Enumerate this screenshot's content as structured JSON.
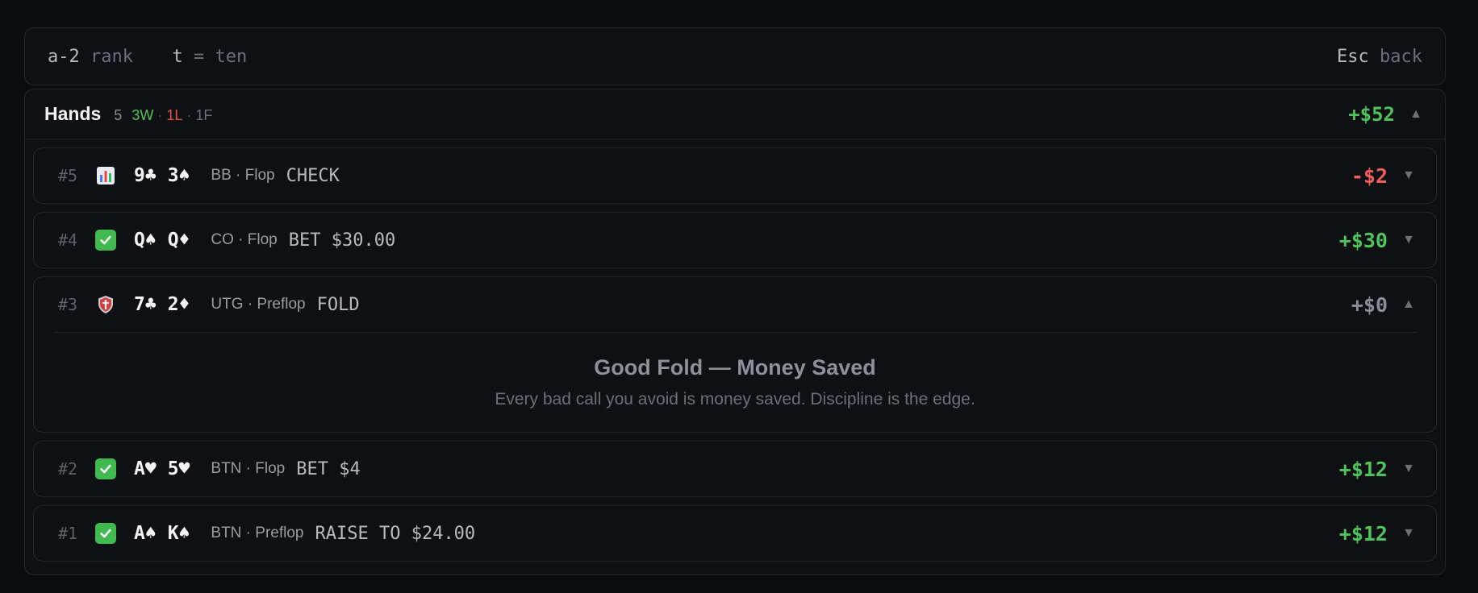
{
  "hints": {
    "rank_key": "a-2",
    "rank_desc": "rank",
    "ten_key": "t",
    "ten_desc": "= ten",
    "esc_key": "Esc",
    "esc_desc": "back"
  },
  "panel": {
    "title": "Hands",
    "count": "5",
    "wins": "3W",
    "losses": "1L",
    "folds": "1F",
    "dot": "·",
    "total": "+$52",
    "caret": "▲"
  },
  "hands": [
    {
      "id": "#5",
      "icon": "chart-icon",
      "card1": "9♣",
      "card2": "3♠",
      "meta": "BB · Flop",
      "action": "CHECK",
      "profit": "-$2",
      "caret": "▼"
    },
    {
      "id": "#4",
      "icon": "check-icon",
      "card1": "Q♠",
      "card2": "Q♦",
      "meta": "CO · Flop",
      "action": "BET $30.00",
      "profit": "+$30",
      "caret": "▼"
    },
    {
      "id": "#3",
      "icon": "shield-icon",
      "card1": "7♣",
      "card2": "2♦",
      "meta": "UTG · Preflop",
      "action": "FOLD",
      "profit": "+$0",
      "caret": "▲",
      "detail_title": "Good Fold — Money Saved",
      "detail_sub": "Every bad call you avoid is money saved. Discipline is the edge."
    },
    {
      "id": "#2",
      "icon": "check-icon",
      "card1": "A♥",
      "card2": "5♥",
      "meta": "BTN · Flop",
      "action": "BET $4",
      "profit": "+$12",
      "caret": "▼"
    },
    {
      "id": "#1",
      "icon": "check-icon",
      "card1": "A♠",
      "card2": "K♠",
      "meta": "BTN · Preflop",
      "action": "RAISE TO $24.00",
      "profit": "+$12",
      "caret": "▼"
    }
  ],
  "colors": {
    "win": "#4fc45a",
    "loss": "#ef5e58",
    "neutral": "#8a8d95"
  }
}
